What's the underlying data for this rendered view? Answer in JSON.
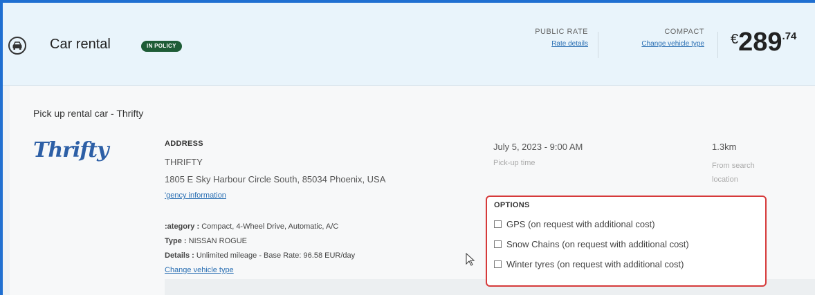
{
  "header": {
    "title": "Car rental",
    "badge": "IN POLICY",
    "public_rate_label": "PUBLIC RATE",
    "rate_details_link": "Rate details",
    "compact_label": "COMPACT",
    "change_vehicle_link": "Change vehicle type",
    "price_currency": "€",
    "price_main": "289",
    "price_cents": ".74"
  },
  "pickup": {
    "title": "Pick up rental car - Thrifty",
    "logo_text": "Thrifty",
    "address_label": "ADDRESS",
    "agency_name": "THRIFTY",
    "address_line": "1805 E Sky Harbour Circle South, 85034 Phoenix, USA",
    "agency_link": "'gency information",
    "category_label": ":ategory :",
    "category_value": "Compact, 4-Wheel Drive, Automatic, A/C",
    "type_label": "Type :",
    "type_value": "NISSAN ROGUE",
    "details_label": "Details :",
    "details_value": "Unlimited mileage - Base Rate: 96.58 EUR/day",
    "change_vehicle_link": "Change vehicle type",
    "datetime": "July 5, 2023 - 9:00 AM",
    "datetime_sub": "Pick-up time",
    "distance": "1.3km",
    "distance_sub": "From search location"
  },
  "options": {
    "title": "OPTIONS",
    "items": [
      {
        "label": "GPS (on request with additional cost)",
        "checked": false
      },
      {
        "label": "Snow Chains (on request with additional cost)",
        "checked": false
      },
      {
        "label": "Winter tyres (on request with additional cost)",
        "checked": false
      }
    ]
  },
  "colors": {
    "accent_border": "#1f6fd1",
    "badge_bg": "#1e5c36",
    "highlight_box": "#d63a3a",
    "link": "#2a6fb3"
  }
}
